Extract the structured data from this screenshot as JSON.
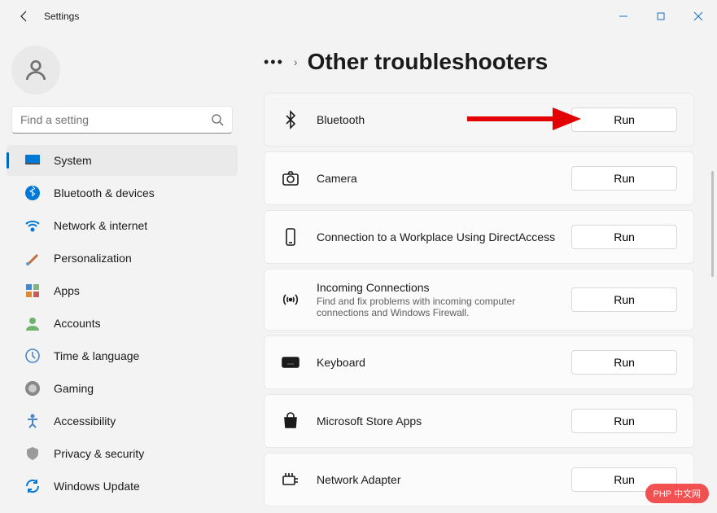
{
  "window": {
    "title": "Settings"
  },
  "search": {
    "placeholder": "Find a setting"
  },
  "nav": {
    "items": [
      {
        "label": "System"
      },
      {
        "label": "Bluetooth & devices"
      },
      {
        "label": "Network & internet"
      },
      {
        "label": "Personalization"
      },
      {
        "label": "Apps"
      },
      {
        "label": "Accounts"
      },
      {
        "label": "Time & language"
      },
      {
        "label": "Gaming"
      },
      {
        "label": "Accessibility"
      },
      {
        "label": "Privacy & security"
      },
      {
        "label": "Windows Update"
      }
    ]
  },
  "breadcrumb": {
    "more": "•••",
    "sep": "›",
    "title": "Other troubleshooters"
  },
  "troubleshooters": [
    {
      "title": "Bluetooth",
      "sub": "",
      "run": "Run"
    },
    {
      "title": "Camera",
      "sub": "",
      "run": "Run"
    },
    {
      "title": "Connection to a Workplace Using DirectAccess",
      "sub": "",
      "run": "Run"
    },
    {
      "title": "Incoming Connections",
      "sub": "Find and fix problems with incoming computer connections and Windows Firewall.",
      "run": "Run"
    },
    {
      "title": "Keyboard",
      "sub": "",
      "run": "Run"
    },
    {
      "title": "Microsoft Store Apps",
      "sub": "",
      "run": "Run"
    },
    {
      "title": "Network Adapter",
      "sub": "",
      "run": "Run"
    }
  ],
  "watermark": {
    "text": "PHP 中文网"
  }
}
